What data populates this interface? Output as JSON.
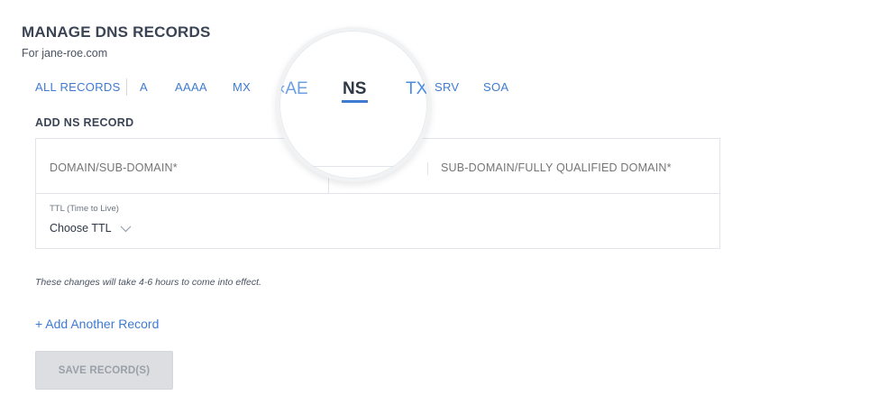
{
  "header": {
    "title": "MANAGE DNS RECORDS",
    "subtitle": "For jane-roe.com"
  },
  "tabs": {
    "all": "ALL RECORDS",
    "a": "A",
    "aaaa": "AAAA",
    "mx": "MX",
    "cname_partial": "‹AE",
    "ns": "NS",
    "txt_partial": "TX",
    "srv": "SRV",
    "soa": "SOA",
    "active": "NS"
  },
  "form": {
    "section_title": "ADD NS RECORD",
    "domain_placeholder": "DOMAIN/SUB-DOMAIN*",
    "target_placeholder": "SUB-DOMAIN/FULLY QUALIFIED DOMAIN*",
    "ttl_label": "TTL (Time to Live)",
    "ttl_value": "Choose TTL"
  },
  "notice": "These changes will take 4-6 hours to come into effect.",
  "add_link": "+ Add Another Record",
  "save_button": "SAVE RECORD(S)",
  "colors": {
    "accent": "#3e7bd1",
    "text": "#3a4454",
    "muted": "#9aa1ab",
    "disabled_bg": "#dcdee1"
  },
  "icons": {
    "ttl_dropdown": "chevron-down-icon"
  }
}
